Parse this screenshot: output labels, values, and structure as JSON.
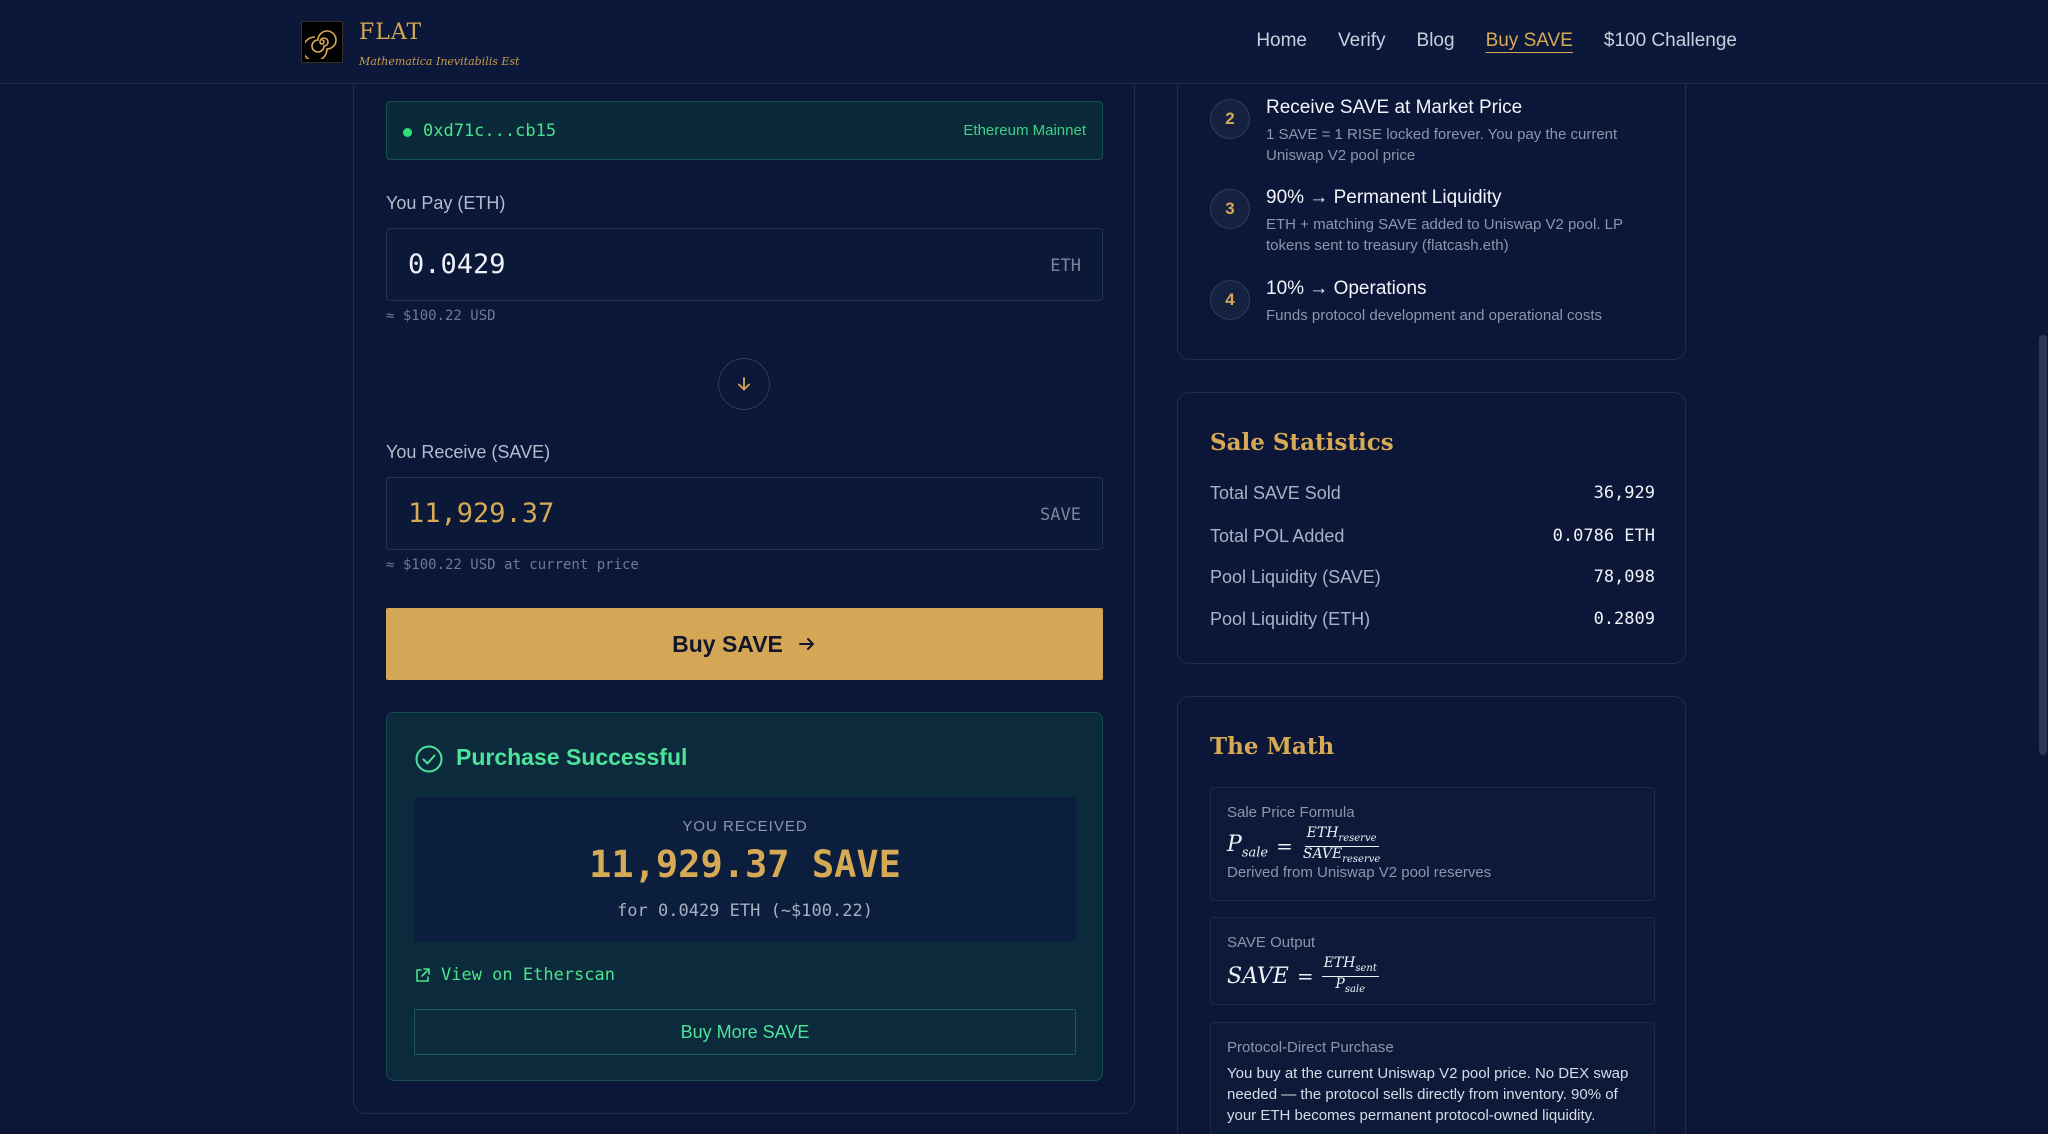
{
  "header": {
    "brand": "FLAT",
    "tagline": "Mathematica Inevitabilis Est",
    "nav": [
      {
        "label": "Home"
      },
      {
        "label": "Verify"
      },
      {
        "label": "Blog"
      },
      {
        "label": "Buy SAVE",
        "active": true
      },
      {
        "label": "$100 Challenge"
      }
    ]
  },
  "wallet": {
    "address": "0xd71c...cb15",
    "network": "Ethereum Mainnet"
  },
  "pay": {
    "label": "You Pay (ETH)",
    "value": "0.0429",
    "unit": "ETH",
    "usd_hint": "≈ $100.22 USD"
  },
  "receive": {
    "label": "You Receive (SAVE)",
    "value": "11,929.37",
    "unit": "SAVE",
    "usd_hint": "≈ $100.22 USD at current price"
  },
  "buy_button": {
    "label": "Buy SAVE"
  },
  "success": {
    "title": "Purchase Successful",
    "received_label": "YOU RECEIVED",
    "amount": "11,929.37 SAVE",
    "sub": "for 0.0429 ETH (~$100.22)",
    "etherscan_label": "View on Etherscan",
    "buy_more_label": "Buy More SAVE"
  },
  "steps": [
    {
      "num": "2",
      "title": "Receive SAVE at Market Price",
      "desc": "1 SAVE = 1 RISE locked forever. You pay the current Uniswap V2 pool price"
    },
    {
      "num": "3",
      "title": "90% → Permanent Liquidity",
      "desc": "ETH + matching SAVE added to Uniswap V2 pool. LP tokens sent to treasury (flatcash.eth)"
    },
    {
      "num": "4",
      "title": "10% → Operations",
      "desc": "Funds protocol development and operational costs"
    }
  ],
  "stats": {
    "title": "Sale Statistics",
    "rows": [
      {
        "label": "Total SAVE Sold",
        "value": "36,929"
      },
      {
        "label": "Total POL Added",
        "value": "0.0786 ETH"
      },
      {
        "label": "Pool Liquidity (SAVE)",
        "value": "78,098"
      },
      {
        "label": "Pool Liquidity (ETH)",
        "value": "0.2809"
      }
    ]
  },
  "math": {
    "title": "The Math",
    "sale_price": {
      "label": "Sale Price Formula",
      "lhs": "P",
      "lhs_sub": "sale",
      "num": "ETH",
      "num_sub": "reserve",
      "den": "SAVE",
      "den_sub": "reserve",
      "note": "Derived from Uniswap V2 pool reserves"
    },
    "save_output": {
      "label": "SAVE Output",
      "lhs": "SAVE",
      "num": "ETH",
      "num_sub": "sent",
      "den": "P",
      "den_sub": "sale"
    },
    "direct": {
      "label": "Protocol-Direct Purchase",
      "text": "You buy at the current Uniswap V2 pool price. No DEX swap needed — the protocol sells directly from inventory. 90% of your ETH becomes permanent protocol-owned liquidity."
    }
  },
  "colors": {
    "accent": "#d4a757",
    "success": "#4ee39a",
    "background": "#0b1638"
  }
}
